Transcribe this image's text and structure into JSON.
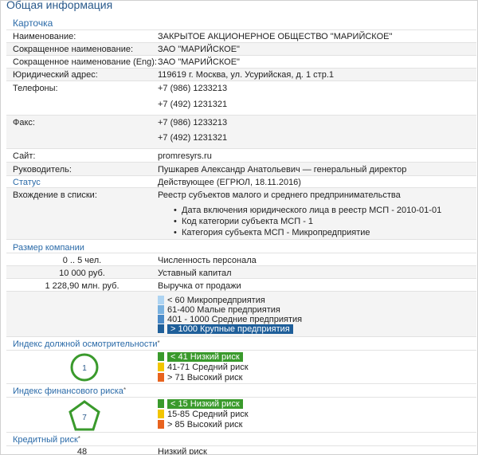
{
  "page_title": "Общая информация",
  "card_title": "Карточка",
  "info_rows": [
    {
      "label": "Наименование:",
      "value": "ЗАКРЫТОЕ АКЦИОНЕРНОЕ ОБЩЕСТВО \"МАРИЙСКОЕ\""
    },
    {
      "label": "Сокращенное наименование:",
      "value": "ЗАО \"МАРИЙСКОЕ\""
    },
    {
      "label": "Сокращенное наименование (Eng):",
      "value": "ЗАО \"МАРИЙСКОЕ\""
    },
    {
      "label": "Юридический адрес:",
      "value": "119619 г. Москва, ул. Усурийская, д. 1 стр.1"
    }
  ],
  "phones": {
    "label": "Телефоны:",
    "values": [
      "+7 (986) 1233213",
      "+7 (492) 1231321"
    ]
  },
  "fax": {
    "label": "Факс:",
    "values": [
      "+7 (986) 1233213",
      "+7 (492) 1231321"
    ]
  },
  "site": {
    "label": "Сайт:",
    "value": "promresyrs.ru"
  },
  "director": {
    "label": "Руководитель:",
    "value": "Пушкарев Александр Анатольевич — генеральный директор"
  },
  "status": {
    "label": "Статус",
    "value": "Действующее (ЕГРЮЛ, 18.11.2016)"
  },
  "lists": {
    "label": "Вхождение в списки:",
    "title": "Реестр субъектов малого и среднего предпринимательства",
    "items": [
      "Дата включения юридического лица в реестр МСП - 2010-01-01",
      "Код категории субъекта МСП - 1",
      "Категория субъекта МСП - Микропредприятие"
    ]
  },
  "size": {
    "title": "Размер компании",
    "rows": [
      {
        "value": "0 .. 5 чел.",
        "label": "Численность персонала"
      },
      {
        "value": "10 000 руб.",
        "label": "Уставный капитал"
      },
      {
        "value": "1 228,90 млн. руб.",
        "label": "Выручка от продажи"
      }
    ],
    "scale": [
      {
        "label": "< 60 Микропредприятия",
        "color": "#aed4f2"
      },
      {
        "label": "61-400 Малые предприятия",
        "color": "#7ab2e0"
      },
      {
        "label": "401 - 1000 Средние предприятия",
        "color": "#4a8ac8"
      },
      {
        "label": "> 1000 Крупные предприятия",
        "color": "#1f5f9a",
        "highlight": true
      }
    ]
  },
  "due_diligence": {
    "title": "Индекс должной осмотрительности",
    "star": "*",
    "score": "1",
    "scale": [
      {
        "label": "< 41 Низкий риск",
        "color": "#3a9a2c",
        "highlight": true
      },
      {
        "label": "41-71 Средний риск",
        "color": "#f2c500"
      },
      {
        "label": "> 71 Высокий риск",
        "color": "#e8631e"
      }
    ]
  },
  "financial_risk": {
    "title": "Индекс финансового риска",
    "star": "*",
    "score": "7",
    "scale": [
      {
        "label": "< 15 Низкий риск",
        "color": "#3a9a2c",
        "highlight": true
      },
      {
        "label": "15-85 Средний риск",
        "color": "#f2c500"
      },
      {
        "label": "> 85 Высокий риск",
        "color": "#e8631e"
      }
    ]
  },
  "credit_risk": {
    "title": "Кредитный риск",
    "star": "*",
    "value": "48",
    "label": "Низкий риск"
  },
  "colors": {
    "accent": "#2a6aa8",
    "badge_green": "#3a9a2c"
  }
}
